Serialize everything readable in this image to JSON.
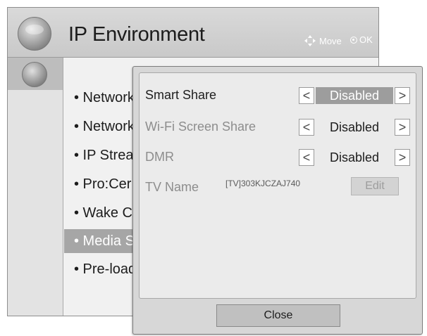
{
  "header": {
    "title": "IP Environment",
    "move_hint": "Move",
    "ok_hint": "OK"
  },
  "menu": {
    "items": [
      {
        "label": "• Network"
      },
      {
        "label": "• Network"
      },
      {
        "label": "• IP Strea"
      },
      {
        "label": "• Pro:Cer"
      },
      {
        "label": "• Wake C"
      },
      {
        "label": "• Media S",
        "selected": true
      },
      {
        "label": "• Pre-load"
      }
    ]
  },
  "popup": {
    "settings": [
      {
        "label": "Smart Share",
        "value": "Disabled",
        "active": true
      },
      {
        "label": "Wi-Fi Screen Share",
        "value": "Disabled",
        "active": false
      },
      {
        "label": "DMR",
        "value": "Disabled",
        "active": false
      }
    ],
    "tv_name_label": "TV Name",
    "tv_name_value": "[TV]303KJCZAJ740",
    "edit_label": "Edit",
    "close_label": "Close",
    "left_arrow": "<",
    "right_arrow": ">"
  },
  "icons": {
    "header_icon": "globe-icon",
    "side_icon": "globe-icon",
    "move_icon": "four-way-arrow-icon",
    "ok_icon": "ok-button-icon"
  }
}
